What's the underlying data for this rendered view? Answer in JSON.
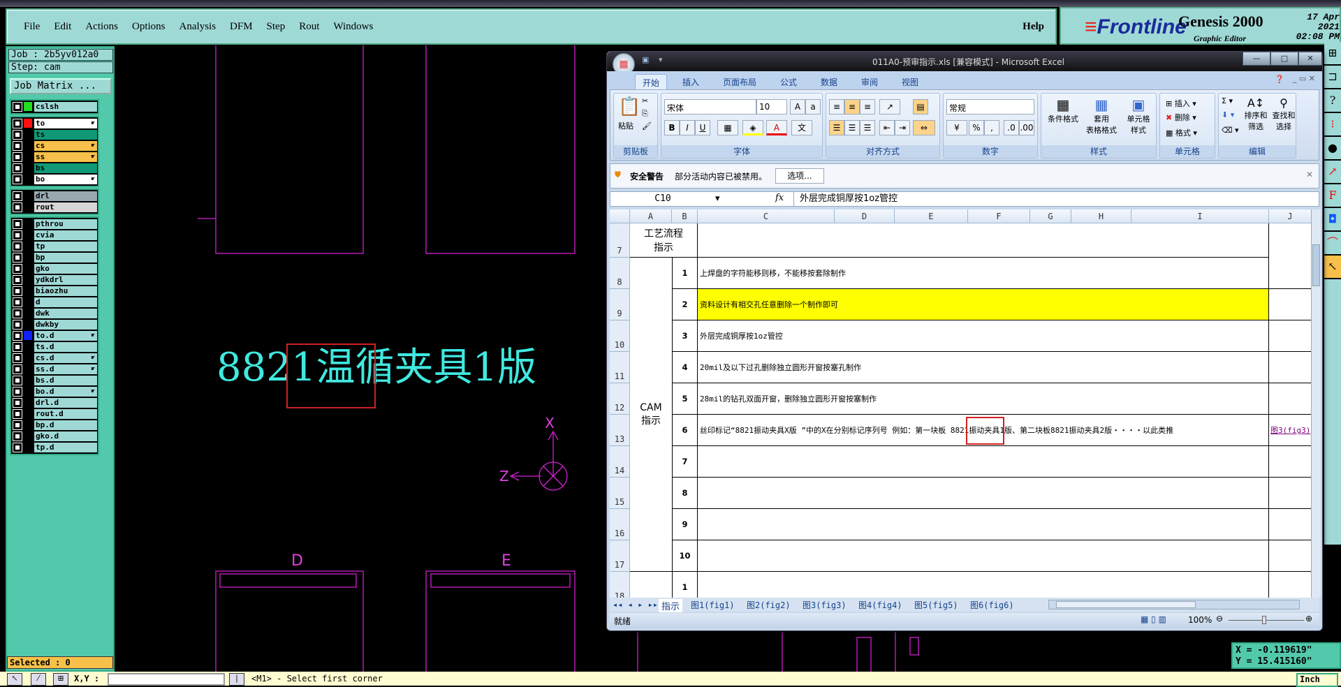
{
  "genesis": {
    "menu": [
      "File",
      "Edit",
      "Actions",
      "Options",
      "Analysis",
      "DFM",
      "Step",
      "Rout",
      "Windows"
    ],
    "help": "Help",
    "logo": {
      "brand": "Frontline",
      "product": "Genesis 2000",
      "subtitle": "Graphic Editor",
      "date": "17 Apr 2021",
      "time": "02:08 PM"
    },
    "job": "Job : 2b5yv012a0",
    "step": "Step: cam",
    "job_matrix": "Job Matrix ...",
    "layer_groups": [
      [
        {
          "name": "cslsh",
          "color": "#22dd22",
          "bg": "#9fd9d6"
        }
      ],
      [
        {
          "name": "to",
          "color": "#ff1010",
          "bg": "#ffffff",
          "hand": true
        },
        {
          "name": "ts",
          "bg": "#119977"
        },
        {
          "name": "cs",
          "bg": "#f7c04a",
          "hand": true
        },
        {
          "name": "ss",
          "bg": "#f7c04a",
          "hand": true
        },
        {
          "name": "bs",
          "bg": "#119977"
        },
        {
          "name": "bo",
          "bg": "#ffffff",
          "hand": true
        }
      ],
      [
        {
          "name": "drl",
          "bg": "#9aa8b0"
        },
        {
          "name": "rout",
          "bg": "#d6d6d6"
        }
      ],
      [
        {
          "name": "pthrou"
        },
        {
          "name": "cvia"
        },
        {
          "name": "tp"
        },
        {
          "name": "bp"
        },
        {
          "name": "gko"
        },
        {
          "name": "ydkdrl"
        },
        {
          "name": "biaozhu"
        },
        {
          "name": "d"
        },
        {
          "name": "dwk"
        },
        {
          "name": "dwkby"
        },
        {
          "name": "to.d",
          "color": "#1020ff",
          "hand": true
        },
        {
          "name": "ts.d"
        },
        {
          "name": "cs.d",
          "hand": true
        },
        {
          "name": "ss.d",
          "hand": true
        },
        {
          "name": "bs.d"
        },
        {
          "name": "bo.d",
          "hand": true
        },
        {
          "name": "drl.d"
        },
        {
          "name": "rout.d"
        },
        {
          "name": "bp.d"
        },
        {
          "name": "gko.d"
        },
        {
          "name": "tp.d"
        }
      ]
    ],
    "selected": "Selected : 0",
    "xy_label": "X,Y :",
    "prompt": "<M1> - Select first corner",
    "units": "Inch",
    "coord_x": "X = -0.119619\"",
    "coord_y": "Y = 15.415160\"",
    "canvas": {
      "text": "8821温循夹具1版",
      "label_d": "D",
      "label_e": "E",
      "axis_x": "X",
      "axis_z": "Z"
    }
  },
  "excel": {
    "title": "011A0-预审指示.xls  [兼容模式] - Microsoft Excel",
    "tabs": [
      "开始",
      "插入",
      "页面布局",
      "公式",
      "数据",
      "审阅",
      "视图"
    ],
    "ribbon": {
      "clipboard": {
        "paste": "粘贴",
        "label": "剪贴板"
      },
      "font": {
        "name": "宋体",
        "size": "10",
        "label": "字体"
      },
      "align": {
        "label": "对齐方式"
      },
      "number": {
        "format": "常规",
        "label": "数字",
        "percent": "%",
        "comma": ","
      },
      "styles": {
        "cond": "条件格式",
        "table": "套用\n表格格式",
        "cell": "单元格\n样式",
        "label": "样式"
      },
      "cells": {
        "insert": "插入",
        "delete": "删除",
        "format": "格式",
        "label": "单元格"
      },
      "edit": {
        "sort": "排序和\n筛选",
        "find": "查找和\n选择",
        "label": "编辑"
      }
    },
    "security": {
      "title": "安全警告",
      "message": "部分活动内容已被禁用。",
      "button": "选项..."
    },
    "name_box": "C10",
    "formula": "外层完成铜厚按1oz管控",
    "columns": [
      "A",
      "B",
      "C",
      "D",
      "E",
      "F",
      "G",
      "H",
      "I",
      "J"
    ],
    "header_row": {
      "num": "7",
      "a": "工艺流程\n指示"
    },
    "group_label": "CAM\n指示",
    "rows": [
      {
        "num": "8",
        "b": "1",
        "c": "上焊盘的字符能移则移，不能移按套除制作"
      },
      {
        "num": "9",
        "b": "2",
        "c": "资料设计有相交孔任意删除一个制作即可",
        "highlight": "#ffff00"
      },
      {
        "num": "10",
        "b": "3",
        "c": "外层完成铜厚按1oz管控"
      },
      {
        "num": "11",
        "b": "4",
        "c": "20mil及以下过孔删除独立圆形开窗按塞孔制作"
      },
      {
        "num": "12",
        "b": "5",
        "c": "28mil的钻孔双面开窗，删除独立圆形开窗按塞制作"
      },
      {
        "num": "13",
        "b": "6",
        "c": "丝印标记“8821振动夹具X版 ”中的X在分别标记序列号  例如：第一块板 8821振动夹具1版、第二块板8821振动夹具2版・・・・以此类推",
        "j": "图3(fig3)"
      },
      {
        "num": "14",
        "b": "7",
        "c": ""
      },
      {
        "num": "15",
        "b": "8",
        "c": ""
      },
      {
        "num": "16",
        "b": "9",
        "c": ""
      },
      {
        "num": "17",
        "b": "10",
        "c": ""
      },
      {
        "num": "18",
        "b": "1",
        "c": ""
      }
    ],
    "sheets": [
      "指示",
      "图1(fig1)",
      "图2(fig2)",
      "图3(fig3)",
      "图4(fig4)",
      "图5(fig5)",
      "图6(fig6)"
    ],
    "status": "就绪",
    "zoom": "100%"
  }
}
